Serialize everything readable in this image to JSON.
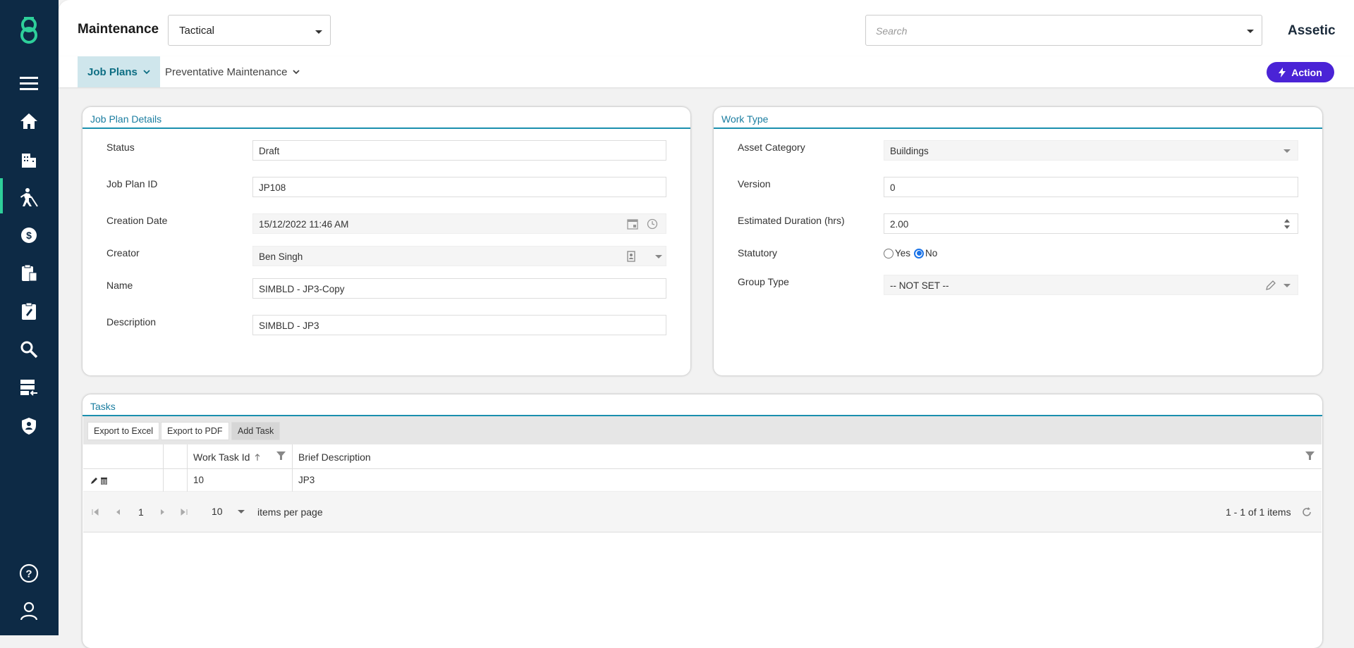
{
  "app": {
    "title": "Maintenance",
    "brand": "Assetic"
  },
  "module_select": {
    "value": "Tactical"
  },
  "search": {
    "placeholder": "Search"
  },
  "subnav": {
    "tabs": [
      {
        "label": "Job Plans"
      },
      {
        "label": "Preventative Maintenance"
      }
    ],
    "action_label": "Action"
  },
  "sidebar": {
    "icons": [
      "logo-icon",
      "menu-icon",
      "home-icon",
      "buildings-icon",
      "maintenance-worker-icon",
      "finance-icon",
      "assets-clipboard-icon",
      "work-order-icon",
      "search-icon",
      "data-transfer-icon",
      "security-shield-icon",
      "help-icon",
      "user-icon"
    ],
    "accent": "#2ecf9a"
  },
  "job_plan_details": {
    "title": "Job Plan Details",
    "status_label": "Status",
    "status_value": "Draft",
    "id_label": "Job Plan ID",
    "id_value": "JP108",
    "date_label": "Creation Date",
    "date_value": "15/12/2022 11:46 AM",
    "creator_label": "Creator",
    "creator_value": "Ben Singh",
    "name_label": "Name",
    "name_value": "SIMBLD - JP3-Copy",
    "desc_label": "Description",
    "desc_value": "SIMBLD - JP3"
  },
  "work_type": {
    "title": "Work Type",
    "category_label": "Asset Category",
    "category_value": "Buildings",
    "version_label": "Version",
    "version_value": "0",
    "duration_label": "Estimated Duration (hrs)",
    "duration_value": "2.00",
    "statutory_label": "Statutory",
    "yes_label": "Yes",
    "no_label": "No",
    "statutory_selected": "No",
    "group_label": "Group Type",
    "group_value": "-- NOT SET --"
  },
  "tasks": {
    "title": "Tasks",
    "export_excel": "Export to Excel",
    "export_pdf": "Export to PDF",
    "add_task": "Add Task",
    "columns": [
      "Work Task Id",
      "Brief Description"
    ],
    "rows": [
      {
        "id": "10",
        "desc": "JP3"
      }
    ],
    "page": "1",
    "page_size": "10",
    "per_page_label": "items per page",
    "summary": "1 - 1 of 1 items"
  },
  "colors": {
    "sidebar": "#0d2a45",
    "action": "#4a23d6",
    "panel_accent": "#1a8fae"
  }
}
